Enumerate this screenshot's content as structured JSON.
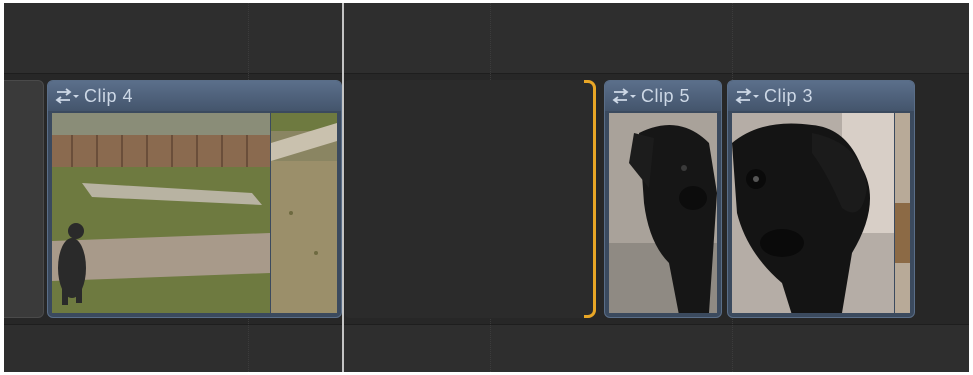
{
  "timeline": {
    "clips": [
      {
        "label": "Clip 4",
        "icon": "audio-video-arrows-icon"
      },
      {
        "label": "Clip 5",
        "icon": "audio-video-arrows-icon"
      },
      {
        "label": "Clip 3",
        "icon": "audio-video-arrows-icon"
      }
    ]
  },
  "colors": {
    "clip_header": "#5b6f8b",
    "selection_bracket": "#e8a626",
    "playhead": "#c4c4c4",
    "background": "#2d2d2d"
  }
}
